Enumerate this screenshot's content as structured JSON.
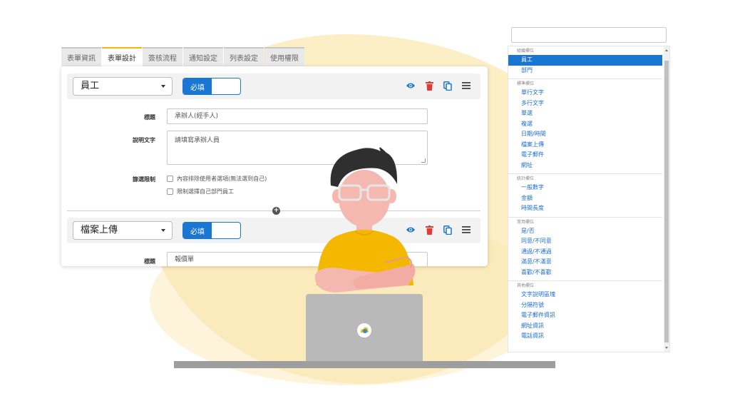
{
  "tabs": [
    "表單資訊",
    "表單設計",
    "簽核流程",
    "通知設定",
    "列表設定",
    "使用權限"
  ],
  "active_tab_index": 1,
  "field1": {
    "type_label": "員工",
    "required_label": "必填",
    "title_label": "標題",
    "title_value": "承辦人(經手人)",
    "desc_label": "說明文字",
    "desc_value": "請填寫承辦人員",
    "filter_label": "篩選限制",
    "option1": "內容排除使用者選項(無法選到自己)",
    "option2": "限制選擇自己部門員工"
  },
  "field2": {
    "type_label": "檔案上傳",
    "required_label": "必填",
    "title_label": "標題",
    "title_value": "報價單"
  },
  "icons": [
    "eye-icon",
    "trash-icon",
    "copy-icon",
    "menu-icon"
  ],
  "colors": {
    "accent": "#1976d2",
    "tab_accent": "#f5b800",
    "delete": "#e53935",
    "link": "#1e6fc9"
  },
  "palette": {
    "groups": [
      {
        "title": "組織欄位",
        "items": [
          "員工",
          "部門"
        ]
      },
      {
        "title": "標準欄位",
        "items": [
          "單行文字",
          "多行文字",
          "單選",
          "複選",
          "日期/時間",
          "檔案上傳",
          "電子郵件",
          "網址"
        ]
      },
      {
        "title": "統計欄位",
        "items": [
          "一般數字",
          "金額",
          "時間長度"
        ]
      },
      {
        "title": "常用欄位",
        "items": [
          "是/否",
          "同意/不同意",
          "通過/不通過",
          "滿意/不滿意",
          "喜歡/不喜歡"
        ]
      },
      {
        "title": "其他欄位",
        "items": [
          "文字說明區塊",
          "分隔符號",
          "電子郵件資訊",
          "網址資訊",
          "電話資訊"
        ]
      }
    ]
  }
}
